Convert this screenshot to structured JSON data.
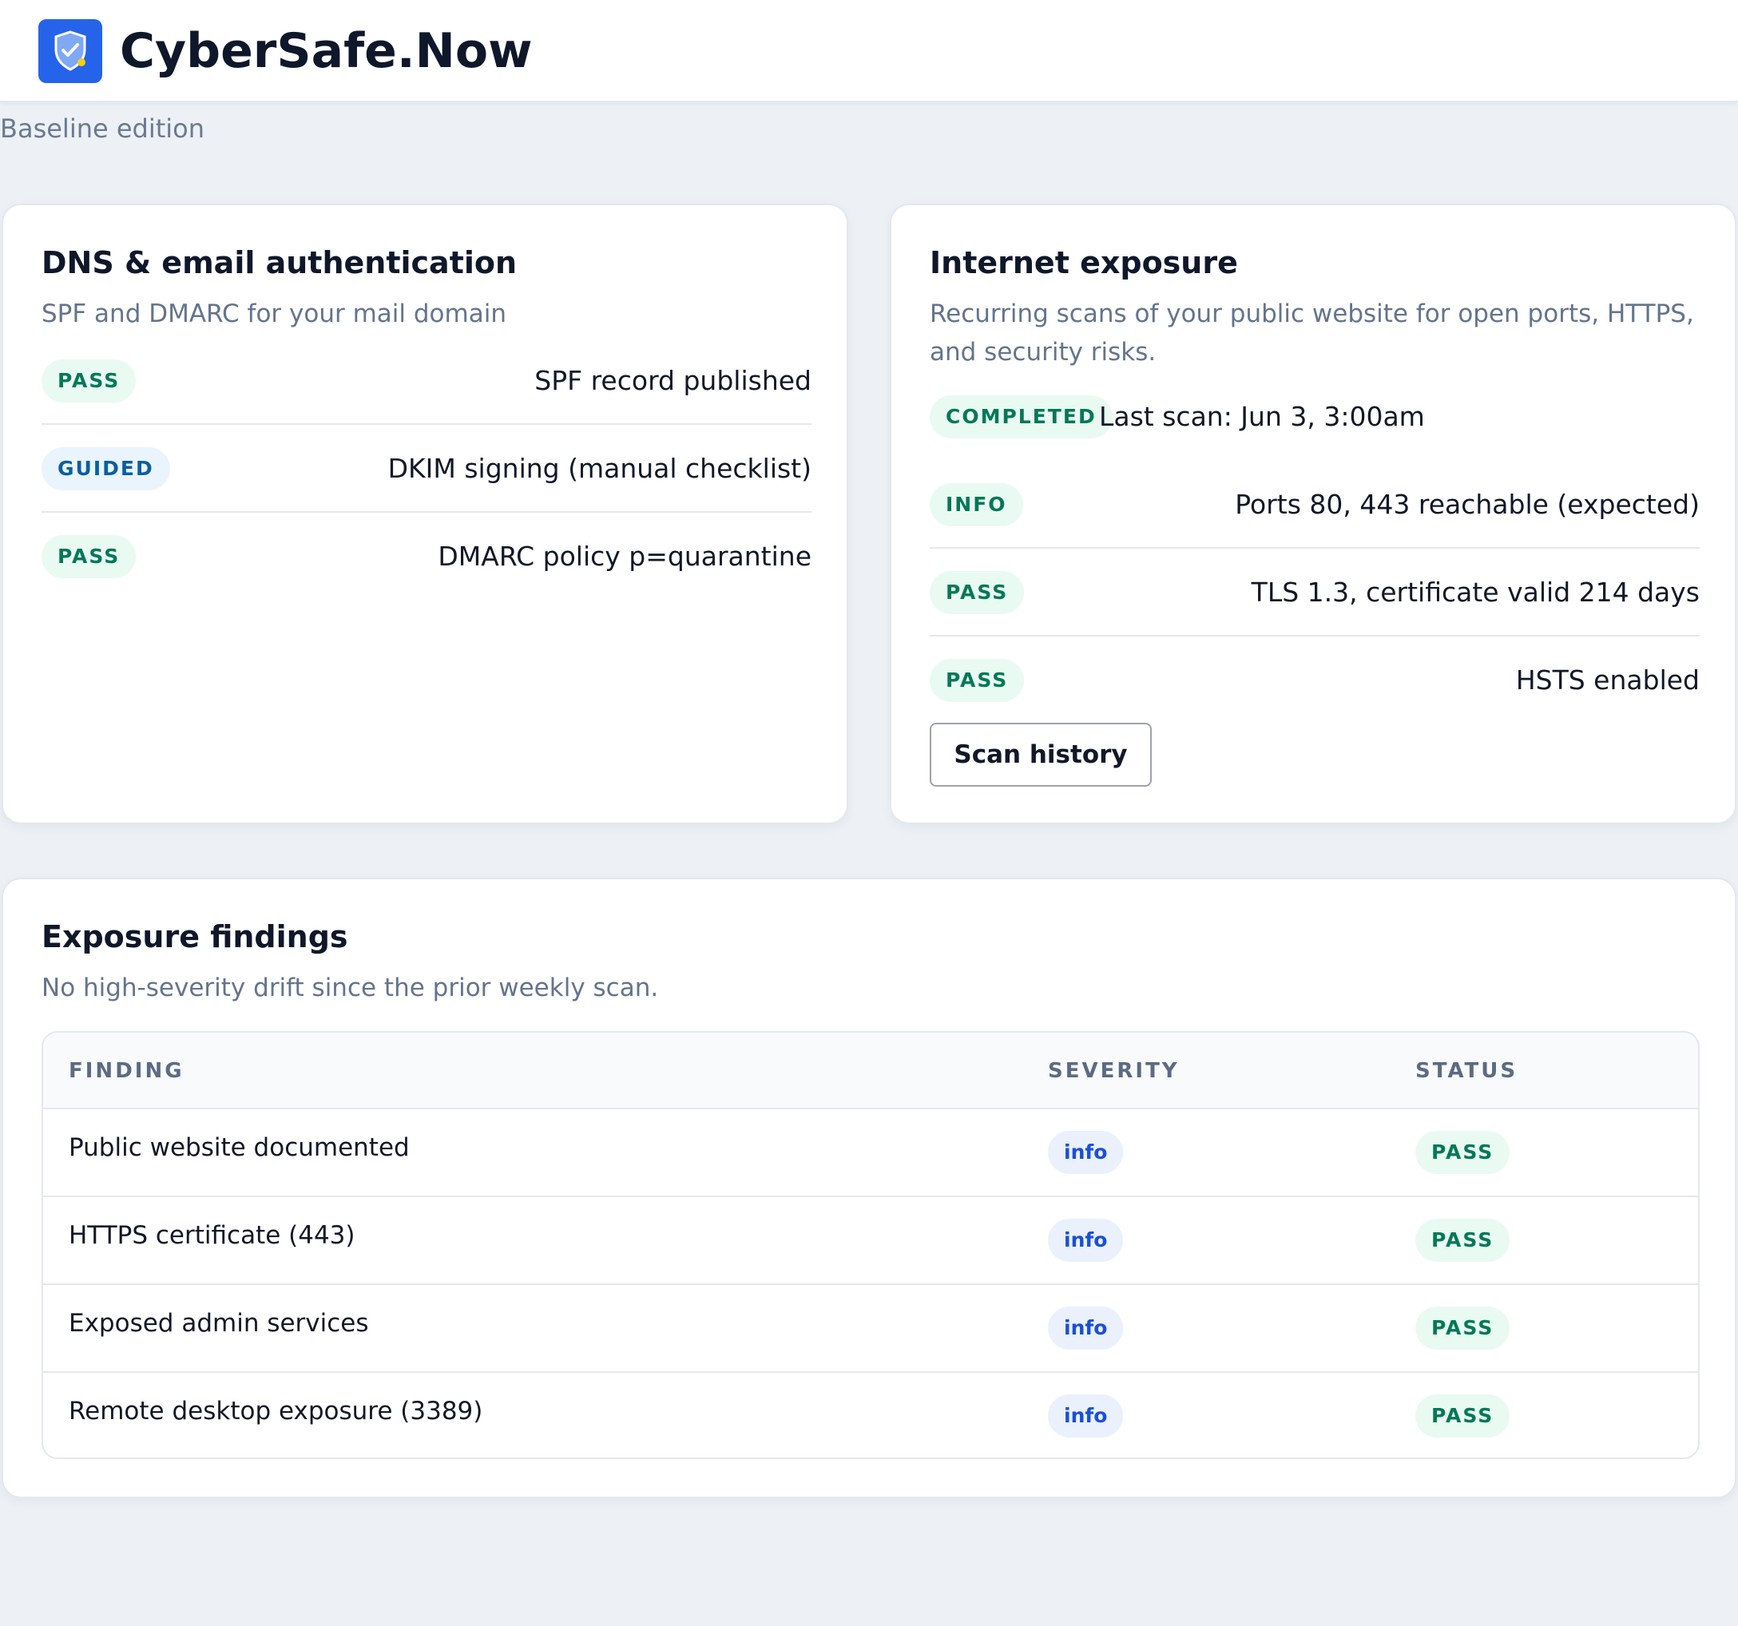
{
  "header": {
    "brand": "CyberSafe.Now",
    "logo_icon": "shield-check-icon",
    "edition": "Baseline edition"
  },
  "colors": {
    "accent": "#2563eb",
    "pass_text": "#047857",
    "pass_bg": "#e9faf2",
    "info_text": "#1d4ed8"
  },
  "dns_card": {
    "title": "DNS & email authentication",
    "subtitle": "SPF and DMARC for your mail domain",
    "checks": [
      {
        "badge": "PASS",
        "text": "SPF record published"
      },
      {
        "badge": "GUIDED",
        "text": "DKIM signing (manual checklist)"
      },
      {
        "badge": "PASS",
        "text": "DMARC policy p=quarantine"
      }
    ]
  },
  "exposure_card": {
    "title": "Internet exposure",
    "subtitle": "Recurring scans of your public website for open ports, HTTPS, and security risks.",
    "scan_status": "COMPLETED",
    "last_scan": "Last scan: Jun 3, 3:00am",
    "checks": [
      {
        "badge": "INFO",
        "text": "Ports 80, 443 reachable (expected)"
      },
      {
        "badge": "PASS",
        "text": "TLS 1.3, certificate valid 214 days"
      },
      {
        "badge": "PASS",
        "text": "HSTS enabled"
      }
    ],
    "scan_history_label": "Scan history"
  },
  "findings_card": {
    "title": "Exposure findings",
    "subtitle": "No high-severity drift since the prior weekly scan.",
    "columns": [
      "FINDING",
      "SEVERITY",
      "STATUS"
    ],
    "rows": [
      {
        "finding": "Public website documented",
        "severity": "info",
        "status": "PASS"
      },
      {
        "finding": "HTTPS certificate (443)",
        "severity": "info",
        "status": "PASS"
      },
      {
        "finding": "Exposed admin services",
        "severity": "info",
        "status": "PASS"
      },
      {
        "finding": "Remote desktop exposure (3389)",
        "severity": "info",
        "status": "PASS"
      }
    ]
  }
}
